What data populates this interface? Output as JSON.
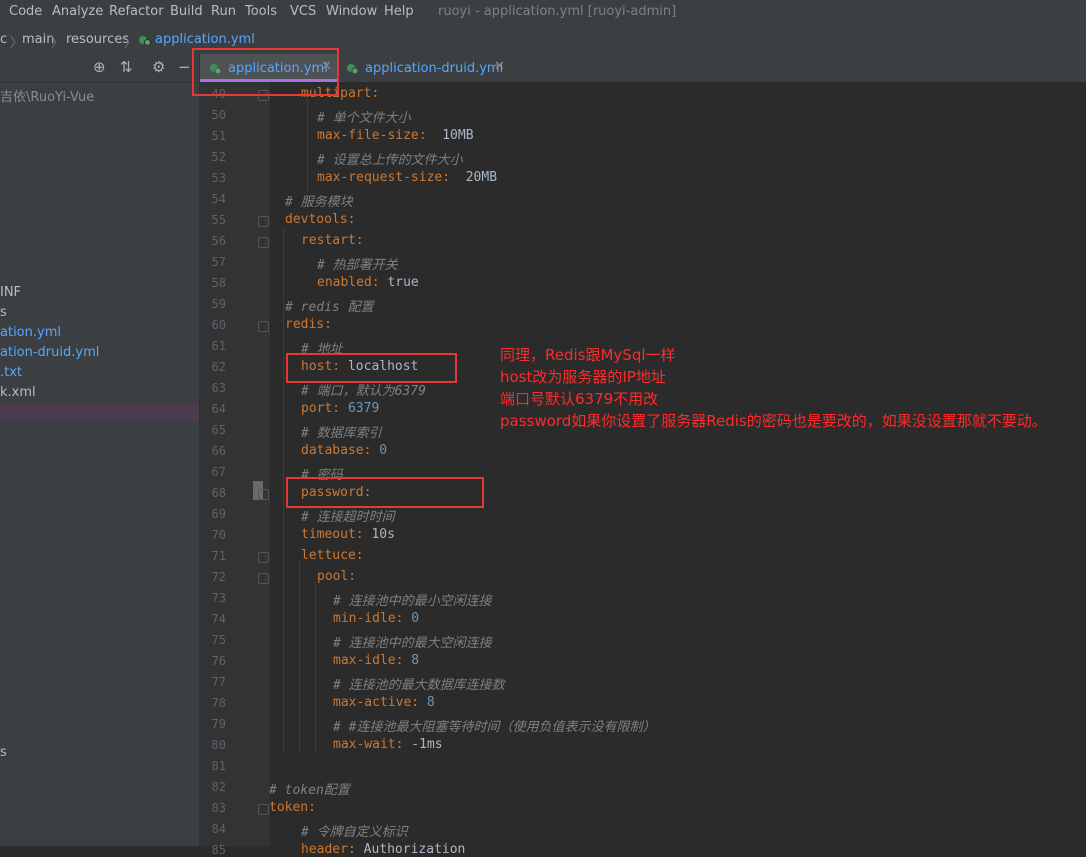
{
  "menu": [
    "Code",
    "Analyze",
    "Refactor",
    "Build",
    "Run",
    "Tools",
    "VCS",
    "Window",
    "Help"
  ],
  "window_title": "ruoyi - application.yml [ruoyi-admin]",
  "breadcrumb": [
    "c",
    "main",
    "resources",
    "application.yml"
  ],
  "sidebar": {
    "items": [
      "吉依\\RuoYi-Vue",
      "INF",
      "s",
      "ation.yml",
      "ation-druid.yml",
      ".txt",
      "k.xml",
      "s"
    ]
  },
  "tabs": [
    {
      "label": "application.yml",
      "active": true
    },
    {
      "label": "application-druid.yml",
      "active": false
    }
  ],
  "lines": [
    {
      "n": "49",
      "indent": 2,
      "key": "multipart:",
      "val": ""
    },
    {
      "n": "50",
      "indent": 3,
      "comment": "# 单个文件大小"
    },
    {
      "n": "51",
      "indent": 3,
      "key": "max-file-size:",
      "val": "  10MB"
    },
    {
      "n": "52",
      "indent": 3,
      "comment": "# 设置总上传的文件大小"
    },
    {
      "n": "53",
      "indent": 3,
      "key": "max-request-size:",
      "val": "  20MB"
    },
    {
      "n": "54",
      "indent": 1,
      "comment": "# 服务模块"
    },
    {
      "n": "55",
      "indent": 1,
      "key": "devtools:",
      "val": ""
    },
    {
      "n": "56",
      "indent": 2,
      "key": "restart:",
      "val": ""
    },
    {
      "n": "57",
      "indent": 3,
      "comment": "# 热部署开关"
    },
    {
      "n": "58",
      "indent": 3,
      "key": "enabled:",
      "val": " true"
    },
    {
      "n": "59",
      "indent": 1,
      "comment": "# redis 配置"
    },
    {
      "n": "60",
      "indent": 1,
      "key": "redis:",
      "val": ""
    },
    {
      "n": "61",
      "indent": 2,
      "comment": "# 地址"
    },
    {
      "n": "62",
      "indent": 2,
      "key": "host:",
      "val": " localhost"
    },
    {
      "n": "63",
      "indent": 2,
      "comment": "# 端口，默认为6379"
    },
    {
      "n": "64",
      "indent": 2,
      "key": "port:",
      "num": " 6379"
    },
    {
      "n": "65",
      "indent": 2,
      "comment": "# 数据库索引"
    },
    {
      "n": "66",
      "indent": 2,
      "key": "database:",
      "num": " 0"
    },
    {
      "n": "67",
      "indent": 2,
      "comment": "# 密码"
    },
    {
      "n": "68",
      "indent": 2,
      "key": "password:",
      "val": ""
    },
    {
      "n": "69",
      "indent": 2,
      "comment": "# 连接超时时间"
    },
    {
      "n": "70",
      "indent": 2,
      "key": "timeout:",
      "val": " 10s"
    },
    {
      "n": "71",
      "indent": 2,
      "key": "lettuce:",
      "val": ""
    },
    {
      "n": "72",
      "indent": 3,
      "key": "pool:",
      "val": ""
    },
    {
      "n": "73",
      "indent": 4,
      "comment": "# 连接池中的最小空闲连接"
    },
    {
      "n": "74",
      "indent": 4,
      "key": "min-idle:",
      "num": " 0"
    },
    {
      "n": "75",
      "indent": 4,
      "comment": "# 连接池中的最大空闲连接"
    },
    {
      "n": "76",
      "indent": 4,
      "key": "max-idle:",
      "num": " 8"
    },
    {
      "n": "77",
      "indent": 4,
      "comment": "# 连接池的最大数据库连接数"
    },
    {
      "n": "78",
      "indent": 4,
      "key": "max-active:",
      "num": " 8"
    },
    {
      "n": "79",
      "indent": 4,
      "comment": "# #连接池最大阻塞等待时间（使用负值表示没有限制）"
    },
    {
      "n": "80",
      "indent": 4,
      "key": "max-wait:",
      "val": " -1ms"
    },
    {
      "n": "81",
      "indent": 0,
      "val": ""
    },
    {
      "n": "82",
      "indent": 0,
      "comment": "# token配置"
    },
    {
      "n": "83",
      "indent": 0,
      "key": "token:",
      "val": ""
    },
    {
      "n": "84",
      "indent": 2,
      "comment": "# 令牌自定义标识"
    },
    {
      "n": "85",
      "indent": 2,
      "key": "header:",
      "val": " Authorization"
    }
  ],
  "annotation": [
    "同理，Redis跟MySql一样",
    "host改为服务器的IP地址",
    "端口号默认6379不用改",
    "password如果你设置了服务器Redis的密码也是要改的，如果没设置那就不要动。"
  ],
  "colors": {
    "annotation": "#ff2a2a",
    "highlight_box": "#e53935",
    "active_tab_underline": "#a572e6"
  }
}
